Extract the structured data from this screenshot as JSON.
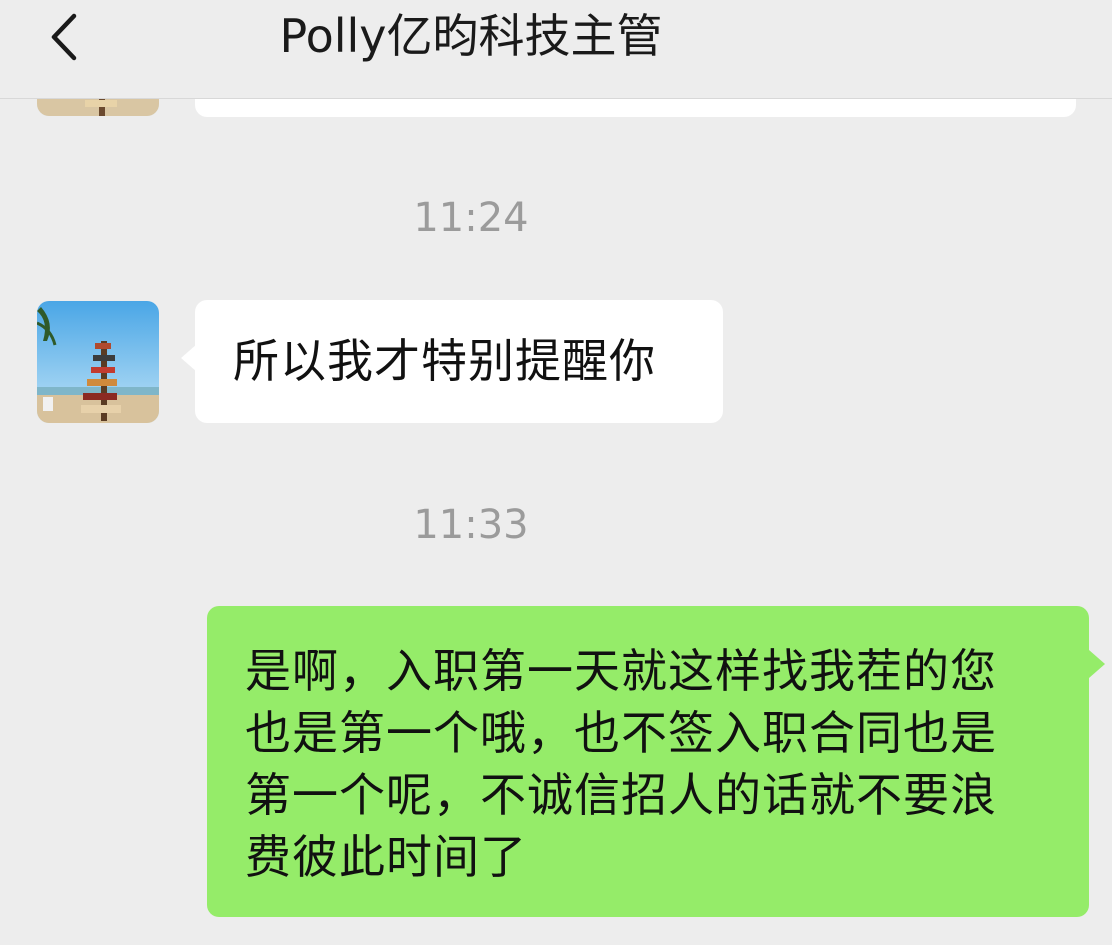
{
  "header": {
    "title": "Polly亿昀科技主管"
  },
  "messages": [
    {
      "type": "timestamp",
      "text": "11:24"
    },
    {
      "type": "incoming",
      "text": "所以我才特别提醒你"
    },
    {
      "type": "timestamp",
      "text": "11:33"
    },
    {
      "type": "outgoing",
      "lines": [
        "是啊，入职第一天就这样找我茬的您",
        "也是第一个哦，也不签入职合同也是",
        "第一个呢，不诚信招人的话就不要浪",
        "费彼此时间了"
      ]
    }
  ],
  "colors": {
    "background": "#ededed",
    "outgoing_bubble": "#95ec69",
    "incoming_bubble": "#ffffff",
    "timestamp_text": "#9b9b9b"
  },
  "icons": {
    "back": "chevron-left-icon",
    "avatar": "beach-signpost-avatar"
  }
}
